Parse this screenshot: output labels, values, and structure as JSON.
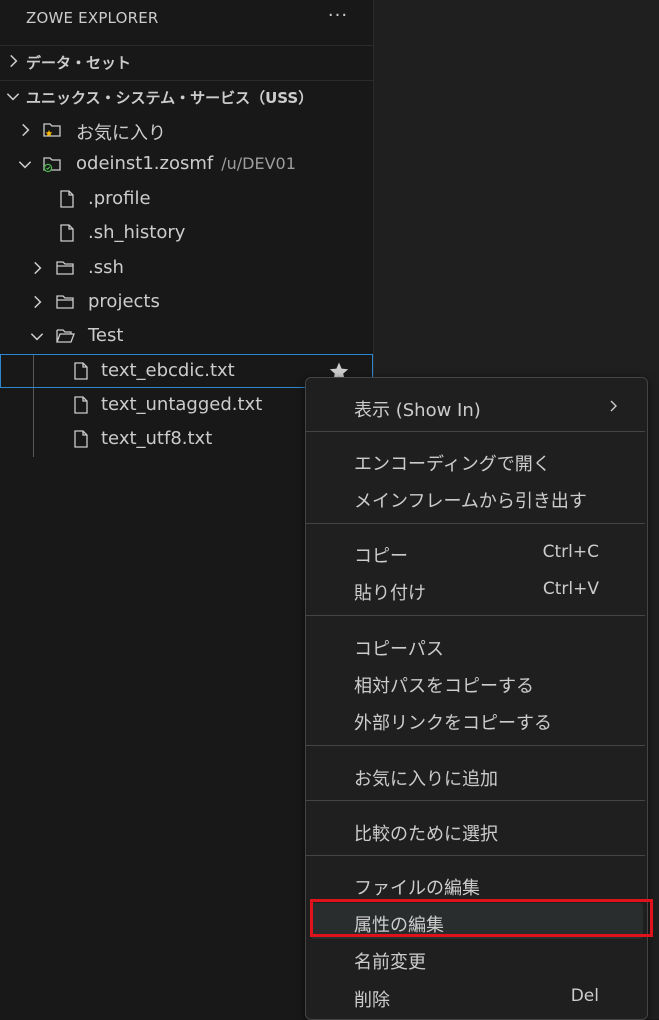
{
  "explorer": {
    "title": "ZOWE EXPLORER",
    "more_label": "···"
  },
  "sections": {
    "datasets": "データ・セット",
    "uss": "ユニックス・システム・サービス（USS）"
  },
  "tree": {
    "favorites": "お気に入り",
    "profile": "odeinst1.zosmf",
    "profile_path": "/u/DEV01",
    "items": [
      ".profile",
      ".sh_history",
      ".ssh",
      "projects",
      "Test",
      "text_ebcdic.txt",
      "text_untagged.txt",
      "text_utf8.txt"
    ]
  },
  "menu": {
    "show_in": "表示 (Show In)",
    "open_with_encoding": "エンコーディングで開く",
    "pull_from_mainframe": "メインフレームから引き出す",
    "copy": "コピー",
    "copy_key": "Ctrl+C",
    "paste": "貼り付け",
    "paste_key": "Ctrl+V",
    "copy_path": "コピーパス",
    "copy_relative_path": "相対パスをコピーする",
    "copy_external_link": "外部リンクをコピーする",
    "add_favorite": "お気に入りに追加",
    "select_for_compare": "比較のために選択",
    "edit_file": "ファイルの編集",
    "edit_attributes": "属性の編集",
    "rename": "名前変更",
    "delete": "削除",
    "delete_key": "Del"
  },
  "colors": {
    "background": "#181818",
    "selection_border": "#2f86d0",
    "annotation_red": "#e0121b",
    "favorite_star": "#f5b800",
    "profile_status": "#4caf50"
  }
}
